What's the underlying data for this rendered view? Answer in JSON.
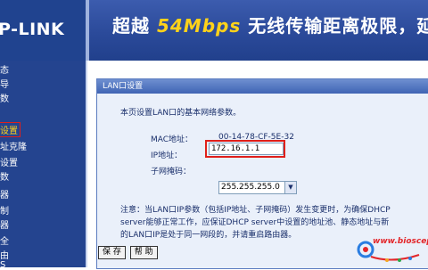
{
  "header": {
    "logo": "P-LINK",
    "banner_prefix": "超越",
    "banner_highlight": "54Mbps",
    "banner_suffix": "无线传输距离极限，延局"
  },
  "sidebar": {
    "items": [
      {
        "label": "态"
      },
      {
        "label": "导"
      },
      {
        "label": "数"
      },
      {
        "label": "设置"
      },
      {
        "label": "址克隆"
      },
      {
        "label": "设置"
      },
      {
        "label": "数"
      },
      {
        "label": "器"
      },
      {
        "label": "制"
      },
      {
        "label": "器"
      },
      {
        "label": "全"
      },
      {
        "label": "由"
      },
      {
        "label": "S"
      }
    ]
  },
  "panel": {
    "title": "LAN口设置",
    "description": "本页设置LAN口的基本网络参数。",
    "mac_label": "MAC地址：",
    "mac_value": "00-14-78-CF-5E-32",
    "ip_label": "IP地址：",
    "ip_value": "172.16.1.1",
    "mask_label": "子网掩码：",
    "mask_value": "255.255.255.0",
    "note_line1": "注意：当LAN口IP参数（包括IP地址、子网掩码）发生变更时，为确保DHCP",
    "note_line2": "server能够正常工作，应保证DHCP server中设置的地址池、静态地址与新",
    "note_line3": "的LAN口IP是处于同一网段的，并请重启路由器。",
    "save_label": "保 存",
    "help_label": "帮 助"
  },
  "watermark": {
    "text": "www.bioscept"
  },
  "colors": {
    "sidebar_bg": "#24448f",
    "panel_bg": "#eaf0fa",
    "highlight_border": "#e0201a"
  }
}
